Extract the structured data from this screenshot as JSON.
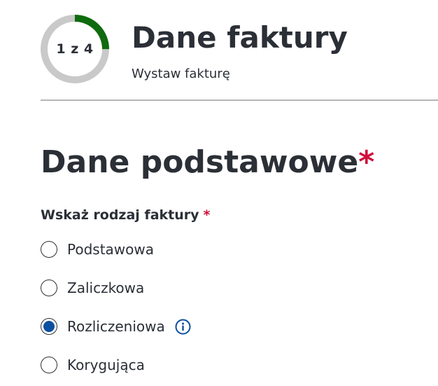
{
  "progress": {
    "label": "1 z 4",
    "current_step": 1,
    "total_steps": 4,
    "color": "#0e6b0e",
    "track_color": "#c9c9c9"
  },
  "header": {
    "title": "Dane faktury",
    "subtitle": "Wystaw fakturę"
  },
  "section": {
    "title": "Dane podstawowe",
    "required_mark": "*"
  },
  "invoice_type": {
    "label": "Wskaż rodzaj faktury",
    "required_mark": "*",
    "selected_index": 2,
    "options": [
      {
        "label": "Podstawowa",
        "selected": false,
        "info_icon": false
      },
      {
        "label": "Zaliczkowa",
        "selected": false,
        "info_icon": false
      },
      {
        "label": "Rozliczeniowa",
        "selected": true,
        "info_icon": true
      },
      {
        "label": "Korygująca",
        "selected": false,
        "info_icon": false
      }
    ]
  },
  "colors": {
    "text": "#2b2f36",
    "required": "#d0103a",
    "accent_blue": "#0b4fa0",
    "divider": "#b5b5b5"
  },
  "icons": {
    "info": "info-icon"
  }
}
